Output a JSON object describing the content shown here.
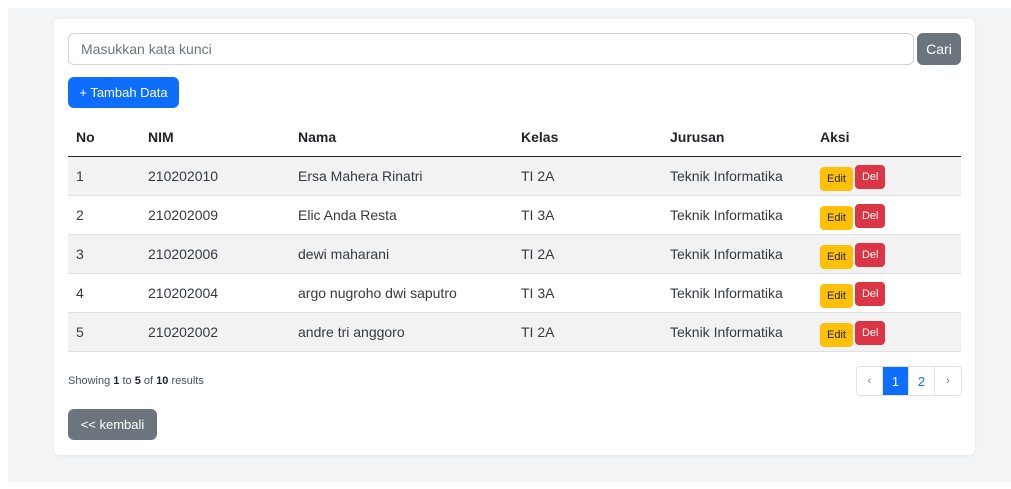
{
  "search": {
    "placeholder": "Masukkan kata kunci",
    "value": "",
    "button_label": "Cari"
  },
  "add_button_label": "+ Tambah Data",
  "table": {
    "headers": [
      "No",
      "NIM",
      "Nama",
      "Kelas",
      "Jurusan",
      "Aksi"
    ],
    "rows": [
      {
        "no": "1",
        "nim": "210202010",
        "nama": "Ersa Mahera Rinatri",
        "kelas": "TI 2A",
        "jurusan": "Teknik Informatika"
      },
      {
        "no": "2",
        "nim": "210202009",
        "nama": "Elic Anda Resta",
        "kelas": "TI 3A",
        "jurusan": "Teknik Informatika"
      },
      {
        "no": "3",
        "nim": "210202006",
        "nama": "dewi maharani",
        "kelas": "TI 2A",
        "jurusan": "Teknik Informatika"
      },
      {
        "no": "4",
        "nim": "210202004",
        "nama": "argo nugroho dwi saputro",
        "kelas": "TI 3A",
        "jurusan": "Teknik Informatika"
      },
      {
        "no": "5",
        "nim": "210202002",
        "nama": "andre tri anggoro",
        "kelas": "TI 2A",
        "jurusan": "Teknik Informatika"
      }
    ],
    "edit_label": "Edit",
    "delete_label": "Del"
  },
  "summary": {
    "prefix": "Showing",
    "from": "1",
    "to_word": "to",
    "to": "5",
    "of_word": "of",
    "total": "10",
    "suffix": "results"
  },
  "pagination": {
    "prev": "‹",
    "pages": [
      "1",
      "2"
    ],
    "current": "1",
    "next": "›"
  },
  "back_button_label": "<< kembali",
  "colors": {
    "primary": "#0d6efd",
    "secondary": "#6c757d",
    "warning": "#ffc107",
    "danger": "#dc3545"
  }
}
